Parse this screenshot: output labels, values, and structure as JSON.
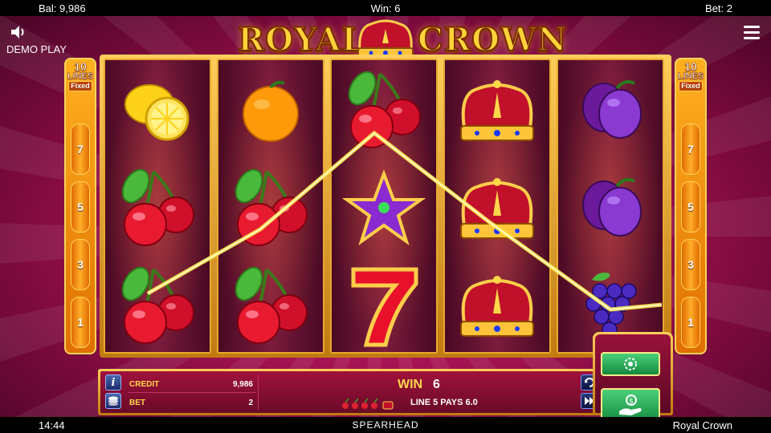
{
  "topbar": {
    "balance": "Bal: 9,986",
    "win": "Win: 6",
    "bet": "Bet: 2"
  },
  "controls": {
    "mode": "DEMO PLAY",
    "sound_icon": "speaker-icon",
    "menu_icon": "hamburger-menu-icon"
  },
  "logo": {
    "word1": "ROYAL",
    "word2": "CROWN"
  },
  "paylines": {
    "count": "10",
    "lines_label": "LINES",
    "fixed_label": "Fixed",
    "left_markers": [
      "7",
      "5",
      "3",
      "1"
    ],
    "right_markers": [
      "7",
      "5",
      "3",
      "1"
    ]
  },
  "reels": [
    [
      "lemon",
      "cherry",
      "cherry"
    ],
    [
      "orange",
      "cherry",
      "cherry"
    ],
    [
      "cherry",
      "star",
      "seven"
    ],
    [
      "crown",
      "crown",
      "crown"
    ],
    [
      "plum",
      "plum",
      "grapes"
    ]
  ],
  "panel": {
    "credit_label": "CREDIT",
    "credit_value": "9,986",
    "bet_label": "BET",
    "bet_value": "2",
    "win_label": "WIN",
    "win_value": "6",
    "pays_text": "LINE 5 PAYS 6.0",
    "info_icon": "info-icon",
    "stack_icon": "coin-stack-icon",
    "autoplay_icon": "autoplay-icon",
    "turbo_icon": "fast-forward-icon",
    "bet_button_icon": "bet-chip-icon",
    "spin_button_icon": "hand-coin-icon"
  },
  "bottombar": {
    "time": "14:44",
    "provider": "SPEARHEAD",
    "game_name": "Royal Crown"
  },
  "colors": {
    "accent_gold": "#ffd23a",
    "background": "#b01557",
    "button_green": "#2aa85a",
    "payline": "#ffe84a"
  }
}
